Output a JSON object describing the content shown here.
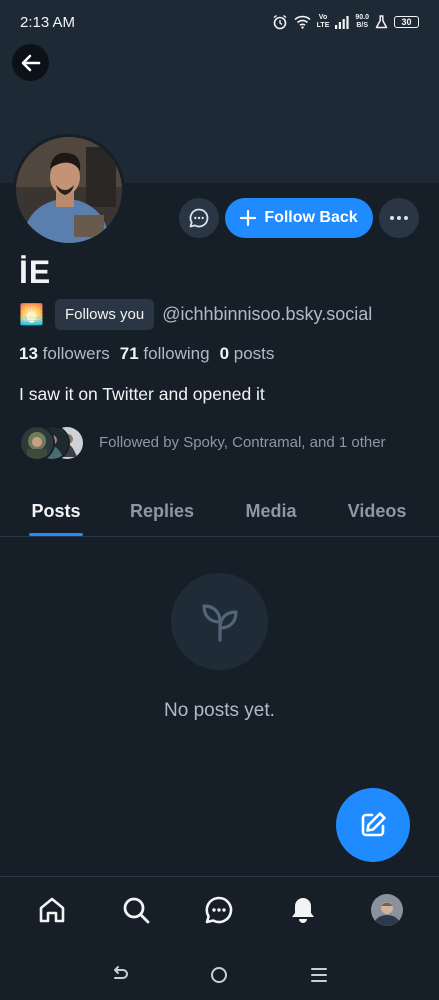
{
  "status_bar": {
    "time": "2:13 AM",
    "network_type_top": "Vo",
    "network_type_bottom": "LTE",
    "speed_value": "90.0",
    "speed_unit": "B/S",
    "battery": "30"
  },
  "profile": {
    "display_name": "İE",
    "emoji": "🌅",
    "follows_you_label": "Follows you",
    "handle": "@ichhbinnisoo.bsky.social",
    "followers_count": "13",
    "followers_label": "followers",
    "following_count": "71",
    "following_label": "following",
    "posts_count": "0",
    "posts_label": "posts",
    "bio": "I saw it on Twitter and opened it",
    "followed_by_text": "Followed by Spoky, Contramal, and 1 other"
  },
  "actions": {
    "follow_back_label": "Follow Back"
  },
  "tabs": [
    {
      "label": "Posts",
      "active": true
    },
    {
      "label": "Replies",
      "active": false
    },
    {
      "label": "Media",
      "active": false
    },
    {
      "label": "Videos",
      "active": false
    }
  ],
  "empty_state": {
    "text": "No posts yet."
  },
  "colors": {
    "background": "#161e27",
    "accent": "#208bfe",
    "muted_text": "#aebbc9"
  },
  "icons": {
    "back": "arrow-left-icon",
    "message": "chat-bubble-icon",
    "more": "ellipsis-icon",
    "empty": "sprout-icon",
    "compose": "compose-icon",
    "nav": [
      "home-icon",
      "search-icon",
      "chat-icon",
      "bell-icon",
      "avatar"
    ]
  }
}
